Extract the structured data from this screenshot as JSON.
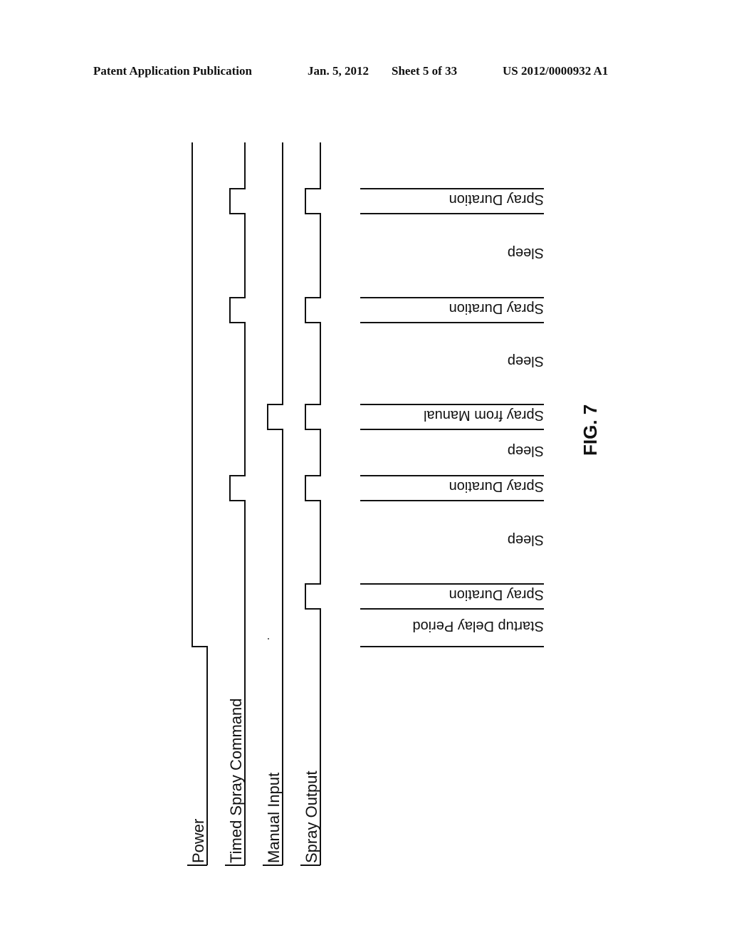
{
  "header": {
    "publication": "Patent Application Publication",
    "date": "Jan. 5, 2012",
    "sheet": "Sheet 5 of 33",
    "patent_number": "US 2012/0000932 A1"
  },
  "figure": {
    "label": "FIG. 7",
    "signals": [
      {
        "name": "Power",
        "pulses": [],
        "step_on_at_period": "Startup Delay Period"
      },
      {
        "name": "Timed Spray Command",
        "pulses": [
          "Spray Duration",
          "Spray Duration",
          "Spray Duration",
          "Spray Duration"
        ]
      },
      {
        "name": "Manual Input",
        "pulses": [
          "Spray from Manual"
        ]
      },
      {
        "name": "Spray Output",
        "pulses": [
          "Spray Duration",
          "Spray Duration",
          "Spray from Manual",
          "Spray Duration",
          "Spray Duration"
        ]
      }
    ],
    "periods": [
      "Startup Delay Period",
      "Spray Duration",
      "Sleep",
      "Spray Duration",
      "Sleep",
      "Spray from Manual",
      "Sleep",
      "Spray Duration",
      "Sleep",
      "Spray Duration"
    ]
  }
}
